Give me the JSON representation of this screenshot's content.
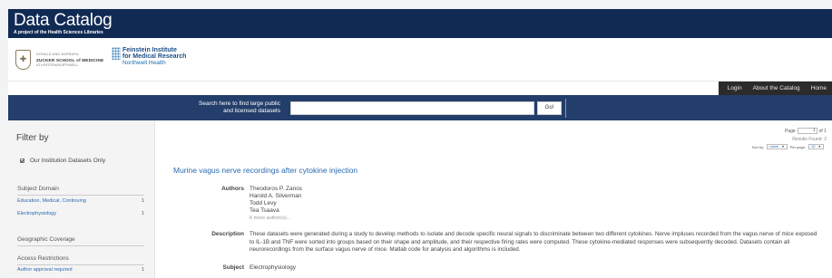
{
  "header": {
    "title": "Data Catalog",
    "subtitle": "A project of the Health Sciences Libraries"
  },
  "logos": {
    "zucker_line1": "DONALD AND BARBARA",
    "zucker_line2": "ZUCKER SCHOOL of MEDICINE",
    "zucker_line3": "AT HOFSTRA/NORTHWELL",
    "feinstein_line1": "Feinstein Institute",
    "feinstein_line2": "for Medical Research",
    "feinstein_line3": "Northwell Health"
  },
  "nav": {
    "login": "Login",
    "about": "About the Catalog",
    "home": "Home"
  },
  "search": {
    "label_line1": "Search here to find large public",
    "label_line2": "and licensed datasets",
    "placeholder": "",
    "go_label": "Go!"
  },
  "sidebar": {
    "filter_title": "Filter by",
    "institution_checkbox": "Our Institution Datasets Only",
    "subject_domain": "Subject Domain",
    "subject_items": [
      {
        "label": "Education, Medical, Continuing",
        "count": "1"
      },
      {
        "label": "Electrophysiology",
        "count": "1"
      }
    ],
    "geographic": "Geographic Coverage",
    "access": "Access Restrictions",
    "access_items": [
      {
        "label": "Author approval required",
        "count": "1"
      }
    ]
  },
  "paging": {
    "page_label": "Page",
    "page_value": "1",
    "of_label": "of 1",
    "results": "Results Found: 2",
    "sort_label": "Sort by:",
    "sort_value": "name",
    "perpage_label": "Per page:",
    "perpage_value": "10"
  },
  "result": {
    "title": "Murine vagus nerve recordings after cytokine injection",
    "authors_label": "Authors",
    "authors": [
      "Theodoros P. Zanos",
      "Harold A. Silverman",
      "Todd Levy",
      "Tea Tsaava"
    ],
    "more_authors": "6 more author(s)...",
    "description_label": "Description",
    "description": "These datasets were generated during a study to develop methods to isolate and decode specific neural signals to discriminate between two different cytokines. Nerve impluses recorded from the vagus nerve of mice exposed to IL-1B and TNF were sorted into groups based on their shape and amplitude, and their respective firing rates were computed. These cytokine-mediated responses were subsequently decoded. Datasets contain all neurorecordings from the surface vagus nerve of mice. Matlab code for analysis and algorithms is included.",
    "subject_label": "Subject",
    "subject": "Electrophysiology"
  }
}
